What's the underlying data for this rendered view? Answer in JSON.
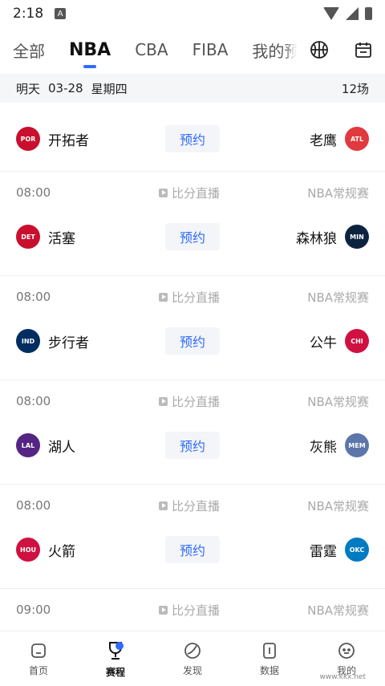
{
  "status": {
    "time": "2:18",
    "indicator": "A"
  },
  "tabs": [
    {
      "label": "全部",
      "active": false
    },
    {
      "label": "NBA",
      "active": true
    },
    {
      "label": "CBA",
      "active": false
    },
    {
      "label": "FIBA",
      "active": false
    },
    {
      "label": "我的预",
      "active": false
    }
  ],
  "icons": {
    "basketball": "basketball-icon",
    "calendar": "calendar-icon"
  },
  "date_bar": {
    "day": "明天",
    "date": "03-28",
    "weekday": "星期四",
    "count": "12场"
  },
  "games": [
    {
      "time": "",
      "live": "",
      "league": "",
      "home": "开拓者",
      "home_abbr": "POR",
      "home_color": "#c8102e",
      "away": "老鹰",
      "away_abbr": "ATL",
      "away_color": "#e03a3e",
      "reserve": "预约"
    },
    {
      "time": "08:00",
      "live": "比分直播",
      "league": "NBA常规赛",
      "home": "活塞",
      "home_abbr": "DET",
      "home_color": "#c8102e",
      "away": "森林狼",
      "away_abbr": "MIN",
      "away_color": "#0c2340",
      "reserve": "预约"
    },
    {
      "time": "08:00",
      "live": "比分直播",
      "league": "NBA常规赛",
      "home": "步行者",
      "home_abbr": "IND",
      "home_color": "#002d62",
      "away": "公牛",
      "away_abbr": "CHI",
      "away_color": "#ce1141",
      "reserve": "预约"
    },
    {
      "time": "08:00",
      "live": "比分直播",
      "league": "NBA常规赛",
      "home": "湖人",
      "home_abbr": "LAL",
      "home_color": "#552583",
      "away": "灰熊",
      "away_abbr": "MEM",
      "away_color": "#5d76a9",
      "reserve": "预约"
    },
    {
      "time": "08:00",
      "live": "比分直播",
      "league": "NBA常规赛",
      "home": "火箭",
      "home_abbr": "HOU",
      "home_color": "#ce1141",
      "away": "雷霆",
      "away_abbr": "OKC",
      "away_color": "#007ac1",
      "reserve": "预约"
    },
    {
      "time": "09:00",
      "live": "比分直播",
      "league": "NBA常规赛",
      "home": "",
      "home_abbr": "",
      "home_color": "#ffffff",
      "away": "",
      "away_abbr": "",
      "away_color": "#ffffff",
      "reserve": ""
    }
  ],
  "nav": [
    {
      "label": "首页",
      "icon": "home-icon",
      "active": false
    },
    {
      "label": "赛程",
      "icon": "trophy-icon",
      "active": true
    },
    {
      "label": "发现",
      "icon": "discover-icon",
      "active": false
    },
    {
      "label": "数据",
      "icon": "data-icon",
      "active": false
    },
    {
      "label": "我的",
      "icon": "profile-icon",
      "active": false
    }
  ],
  "watermark": "www.kkx.net",
  "colors": {
    "accent": "#2f6bff",
    "date_bar_bg": "#f5f6f8",
    "reserve_bg": "#f3f5f9"
  }
}
